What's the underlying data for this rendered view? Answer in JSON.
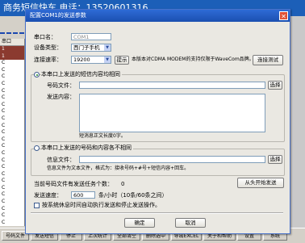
{
  "app": {
    "title": "商务短信快车    电话：13520601316",
    "list_header": "串口",
    "list_rows": [
      "1",
      "1",
      "C",
      "C",
      "C",
      "C",
      "C",
      "C",
      "C",
      "C",
      "C",
      "C",
      "C",
      "C",
      "C",
      "C",
      "C",
      "C",
      "C",
      "C",
      "C",
      "C",
      "C",
      "C",
      "C",
      "C"
    ],
    "bottom_buttons": [
      "号码文件",
      "发送短信",
      "停止",
      "上次统计",
      "全部清空",
      "删除选中",
      "导出EXCEL",
      "关于和帮助",
      "设置",
      "系统"
    ]
  },
  "dialog": {
    "title": "配置COM1的发送参数",
    "close_icon": "close-icon",
    "port_name_label": "串口名：",
    "port_name_value": "COM1",
    "device_type_label": "设备类型：",
    "device_type_value": "西门子手机",
    "baud_label": "连接速率：",
    "baud_value": "19200",
    "hint_button": "提示",
    "support_note": "本版本对CDMA MODEM的支持仅限于WaveCom品牌。",
    "connect_test_button": "连接测试",
    "mode_same_label": "本串口上发送的短信内容均相同",
    "number_file_label": "号码文件：",
    "number_file_value": "",
    "choose_button": "选择",
    "content_label": "发送内容：",
    "content_value": "",
    "length_note": "短消息正文长度0字。",
    "mode_diff_label": "本串口上发送的号码和内容各不相同",
    "info_file_label": "信息文件：",
    "info_file_value": "",
    "choose_button2": "选择",
    "format_note": "信息文件为文本文件，格式为：接收号码+#号+短信内容+回车。",
    "pending_label": "当前号码文件有发送任务个数：",
    "pending_value": "0",
    "restart_button": "从头开始发送",
    "speed_label": "发送速度：",
    "speed_value": "600",
    "speed_unit": "条/小时（10条/60条之间）",
    "auto_continue_label": "按系统休息时间自动执行发送和停止发送操作。",
    "ok_button": "确定",
    "cancel_button": "取消"
  }
}
